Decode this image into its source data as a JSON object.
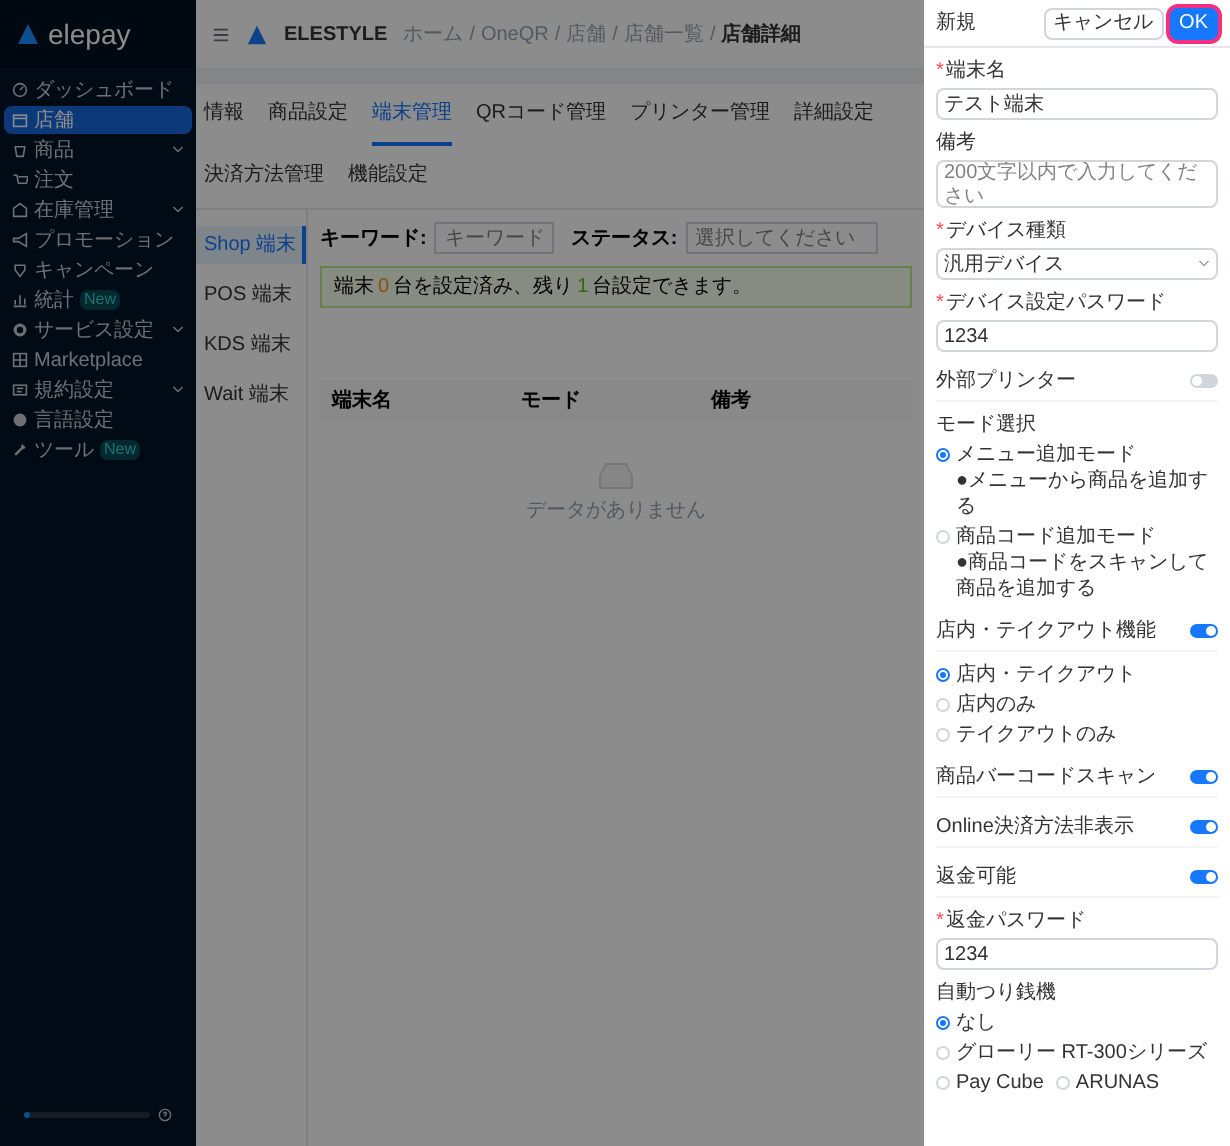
{
  "sidebar": {
    "logo": "elepay",
    "items": [
      {
        "label": "ダッシュボード",
        "selected": false,
        "expandable": false
      },
      {
        "label": "店舗",
        "selected": true,
        "expandable": false
      },
      {
        "label": "商品",
        "selected": false,
        "expandable": true
      },
      {
        "label": "注文",
        "selected": false,
        "expandable": false
      },
      {
        "label": "在庫管理",
        "selected": false,
        "expandable": true
      },
      {
        "label": "プロモーション",
        "selected": false,
        "expandable": false
      },
      {
        "label": "キャンペーン",
        "selected": false,
        "expandable": false
      },
      {
        "label": "統計",
        "selected": false,
        "expandable": false,
        "badge": "New"
      },
      {
        "label": "サービス設定",
        "selected": false,
        "expandable": true
      },
      {
        "label": "Marketplace",
        "selected": false,
        "expandable": false
      },
      {
        "label": "規約設定",
        "selected": false,
        "expandable": true
      },
      {
        "label": "言語設定",
        "selected": false,
        "expandable": false
      },
      {
        "label": "ツール",
        "selected": false,
        "expandable": false,
        "badge": "New"
      }
    ],
    "usage": {
      "level": 0.05
    }
  },
  "header": {
    "brand": "ELESTYLE",
    "breadcrumb": [
      "ホーム",
      "OneQR",
      "店舗",
      "店舗一覧"
    ],
    "separator": "/",
    "current": "店舗詳細"
  },
  "tabs": [
    {
      "label": "情報",
      "selected": false
    },
    {
      "label": "商品設定",
      "selected": false
    },
    {
      "label": "端末管理",
      "selected": true
    },
    {
      "label": "QRコード管理",
      "selected": false
    },
    {
      "label": "プリンター管理",
      "selected": false
    },
    {
      "label": "詳細設定",
      "selected": false
    },
    {
      "label": "決済方法管理",
      "selected": false
    },
    {
      "label": "機能設定",
      "selected": false
    }
  ],
  "terminal_types": [
    {
      "label": "Shop 端末",
      "selected": true
    },
    {
      "label": "POS 端末",
      "selected": false
    },
    {
      "label": "KDS 端末",
      "selected": false
    },
    {
      "label": "Wait 端末",
      "selected": false
    }
  ],
  "filters": {
    "keyword_label": "キーワード:",
    "keyword_placeholder": "キーワード",
    "status_label": "ステータス:",
    "status_placeholder": "選択してください"
  },
  "alert": {
    "before": "端末",
    "used": "0",
    "middle": "台を設定済み、残り",
    "remaining": "1",
    "after": "台設定できます。"
  },
  "table": {
    "columns": [
      "端末名",
      "モード",
      "備考"
    ],
    "empty": "データがありません"
  },
  "drawer": {
    "title": "新規",
    "required_mark": "*",
    "cancel": "キャンセル",
    "ok": "OK",
    "fields": [
      {
        "kind": "input",
        "label": "端末名",
        "required": true,
        "value": "テスト端末"
      },
      {
        "kind": "textarea",
        "label": "備考",
        "required": false,
        "placeholder": "200文字以内で入力してください"
      },
      {
        "kind": "select",
        "label": "デバイス種類",
        "required": true,
        "value": "汎用デバイス"
      },
      {
        "kind": "input",
        "label": "デバイス設定パスワード",
        "required": true,
        "value": "1234"
      },
      {
        "kind": "toggle",
        "label": "外部プリンター",
        "on": false
      },
      {
        "kind": "radios",
        "label": "モード選択",
        "options": [
          {
            "label": "メニュー追加モード",
            "note": "●メニューから商品を追加する",
            "selected": true
          },
          {
            "label": "商品コード追加モード",
            "note": "●商品コードをスキャンして商品を追加する",
            "selected": false
          }
        ]
      },
      {
        "kind": "toggle",
        "label": "店内・テイクアウト機能",
        "on": true
      },
      {
        "kind": "radios",
        "options": [
          {
            "label": "店内・テイクアウト",
            "selected": true
          },
          {
            "label": "店内のみ",
            "selected": false
          },
          {
            "label": "テイクアウトのみ",
            "selected": false
          }
        ]
      },
      {
        "kind": "toggle",
        "label": "商品バーコードスキャン",
        "on": true
      },
      {
        "kind": "toggle",
        "label": "Online決済方法非表示",
        "on": true
      },
      {
        "kind": "toggle",
        "label": "返金可能",
        "on": true
      },
      {
        "kind": "input",
        "label": "返金パスワード",
        "required": true,
        "value": "1234"
      },
      {
        "kind": "inline-radios",
        "label": "自動つり銭機",
        "options": [
          {
            "label": "なし",
            "selected": true
          },
          {
            "label": "グローリー RT-300シリーズ",
            "selected": false
          },
          {
            "label": "Pay Cube",
            "selected": false
          },
          {
            "label": "ARUNAS",
            "selected": false
          }
        ]
      }
    ]
  }
}
